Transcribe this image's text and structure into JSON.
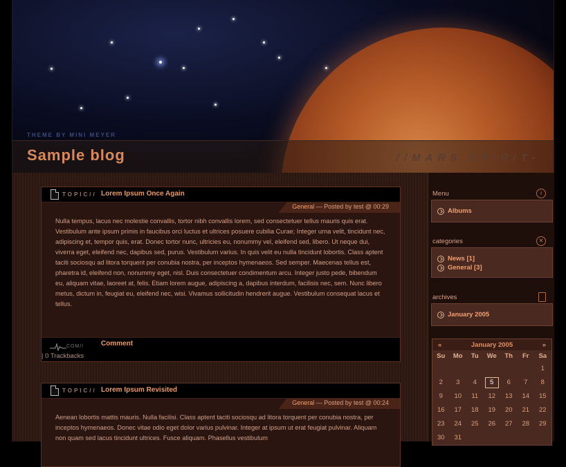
{
  "header": {
    "theme_credit": "THEME BY MINI MEYER",
    "blog_title": "Sample blog",
    "tagline": "//MARS SPIRIT-"
  },
  "posts": [
    {
      "topic_label": "TOPIC//",
      "title": "Lorem Ipsum Once Again",
      "category": "General",
      "meta": " — Posted by test @ 00:29",
      "body": "Nulla tempus, lacus nec molestie convallis, tortor nibh convallis lorem, sed consectetuer tellus mauris quis erat. Vestibulum ante ipsum primis in faucibus orci luctus et ultrices posuere cubilia Curae; Integer urna velit, tincidunt nec, adipiscing et, tempor quis, erat. Donec tortor nunc, ultricies eu, nonummy vel, eleifend sed, libero. Ut neque dui, viverra eget, eleifend nec, dapibus sed, purus. Vestibulum varius. In quis velit eu nulla tincidunt lobortis. Class aptent taciti sociosqu ad litora torquent per conubia nostra, per inceptos hymenaeos. Sed semper. Maecenas tellus est, pharetra id, eleifend non, nonummy eget, nisl. Duis consectetuer condimentum arcu. Integer justo pede, bibendum eu, aliquam vitae, laoreet at, felis. Etiam lorem augue, adipiscing a, dapibus interdum, facilisis nec, sem. Nunc libero metus, dictum in, feugiat eu, eleifend nec, wisi. Vivamus sollicitudin hendrerit augue. Vestibulum consequat lacus et tellus.",
      "com_logo": "COM//",
      "comment_label": "Comment",
      "trackbacks": "| 0 Trackbacks"
    },
    {
      "topic_label": "TOPIC//",
      "title": "Lorem Ipsum Revisited",
      "category": "General",
      "meta": " — Posted by test @ 00:24",
      "body": "Aenean lobortis mattis mauris. Nulla facilisi. Class aptent taciti sociosqu ad litora torquent per conubia nostra, per inceptos hymenaeos. Donec vitae odio eget dolor varius pulvinar. Integer at ipsum ut erat feugiat pulvinar. Aliquam non quam sed lacus tincidunt ultrices. Fusce aliquam. Phasellus vestibulum"
    }
  ],
  "sidebar": {
    "menu": {
      "title": "Menu",
      "icon": "info-icon",
      "items": [
        "Albums"
      ]
    },
    "categories": {
      "title": "categories",
      "icon": "xml-icon",
      "items": [
        "News [1]",
        "General [3]"
      ]
    },
    "archives": {
      "title": "archives",
      "icon": "document-icon",
      "items": [
        "January 2005"
      ]
    }
  },
  "calendar": {
    "prev": "«",
    "month": "January 2005",
    "next": "»",
    "days_of_week": [
      "Su",
      "Mo",
      "Tu",
      "We",
      "Th",
      "Fr",
      "Sa"
    ],
    "weeks": [
      [
        "",
        "",
        "",
        "",
        "",
        "",
        "1"
      ],
      [
        "2",
        "3",
        "4",
        "5",
        "6",
        "7",
        "8"
      ],
      [
        "9",
        "10",
        "11",
        "12",
        "13",
        "14",
        "15"
      ],
      [
        "16",
        "17",
        "18",
        "19",
        "20",
        "21",
        "22"
      ],
      [
        "23",
        "24",
        "25",
        "26",
        "27",
        "28",
        "29"
      ],
      [
        "30",
        "31",
        "",
        "",
        "",
        "",
        ""
      ]
    ],
    "today": "5"
  }
}
